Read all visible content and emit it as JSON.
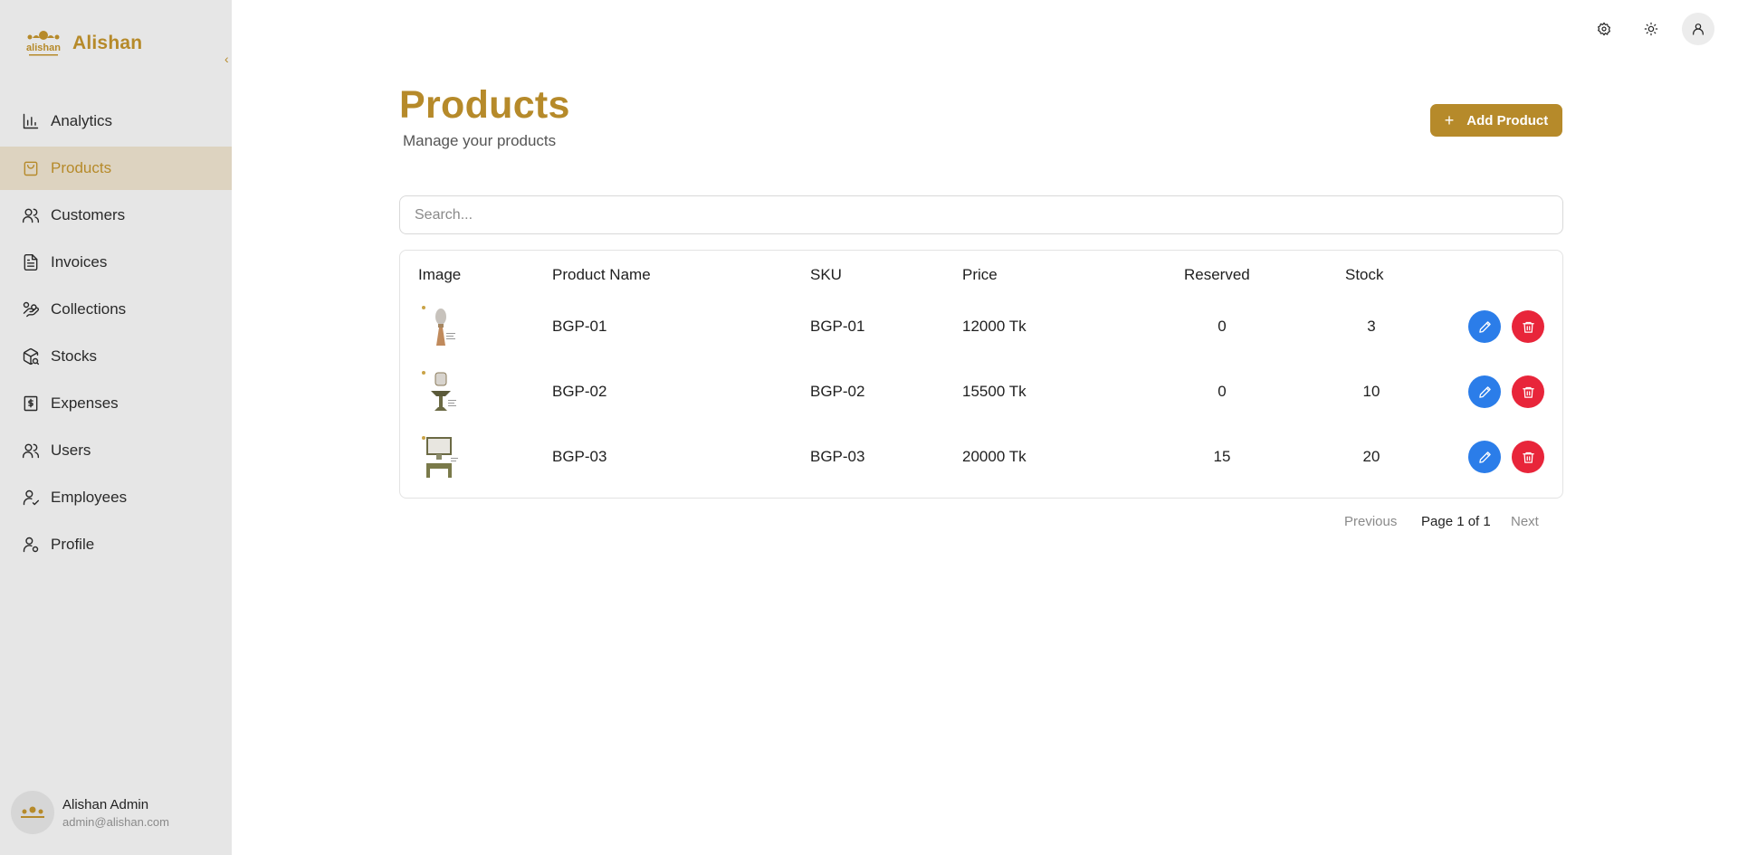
{
  "app": {
    "name": "Alishan",
    "logo_text": "alishan"
  },
  "sidebar": {
    "items": [
      {
        "label": "Analytics",
        "icon": "bar-chart-icon",
        "active": false
      },
      {
        "label": "Products",
        "icon": "shopping-bag-icon",
        "active": true
      },
      {
        "label": "Customers",
        "icon": "users-icon",
        "active": false
      },
      {
        "label": "Invoices",
        "icon": "file-text-icon",
        "active": false
      },
      {
        "label": "Collections",
        "icon": "hand-coins-icon",
        "active": false
      },
      {
        "label": "Stocks",
        "icon": "package-search-icon",
        "active": false
      },
      {
        "label": "Expenses",
        "icon": "receipt-dollar-icon",
        "active": false
      },
      {
        "label": "Users",
        "icon": "users-icon",
        "active": false
      },
      {
        "label": "Employees",
        "icon": "user-check-icon",
        "active": false
      },
      {
        "label": "Profile",
        "icon": "user-cog-icon",
        "active": false
      }
    ],
    "user": {
      "name": "Alishan Admin",
      "email": "admin@alishan.com"
    }
  },
  "header": {
    "title": "Products",
    "subtitle": "Manage your products",
    "add_button": "Add Product",
    "icons": [
      "settings-icon",
      "sun-icon",
      "user-icon"
    ]
  },
  "search": {
    "placeholder": "Search...",
    "value": ""
  },
  "table": {
    "columns": [
      "Image",
      "Product Name",
      "SKU",
      "Price",
      "Reserved",
      "Stock"
    ],
    "rows": [
      {
        "name": "BGP-01",
        "sku": "BGP-01",
        "price": "12000 Tk",
        "reserved": "0",
        "stock": "3"
      },
      {
        "name": "BGP-02",
        "sku": "BGP-02",
        "price": "15500 Tk",
        "reserved": "0",
        "stock": "10"
      },
      {
        "name": "BGP-03",
        "sku": "BGP-03",
        "price": "20000 Tk",
        "reserved": "15",
        "stock": "20"
      }
    ]
  },
  "pagination": {
    "previous": "Previous",
    "info": "Page 1 of 1",
    "next": "Next"
  },
  "colors": {
    "accent": "#b68a2a",
    "edit": "#2b7de9",
    "delete": "#e8253a",
    "sidebar_bg": "#e6e6e6",
    "active_bg": "#ddd3c0"
  }
}
